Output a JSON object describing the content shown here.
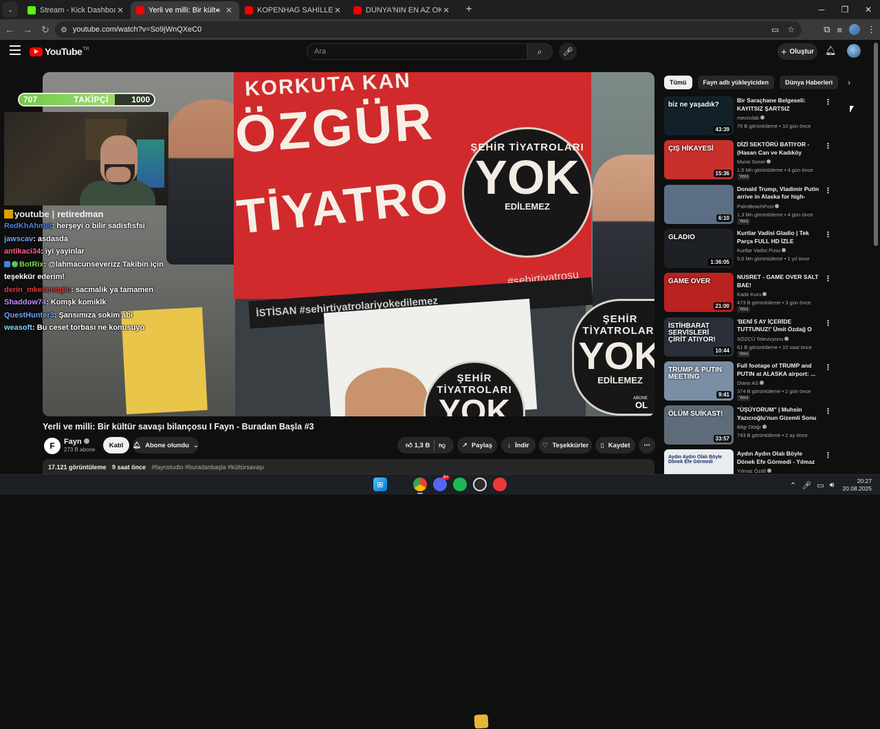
{
  "browser": {
    "tabs": [
      {
        "label": "Stream - Kick Dashboard",
        "icon": "kick-favicon",
        "active": false
      },
      {
        "label": "Yerli ve milli: Bir kültür savaşı",
        "icon": "youtube-favicon",
        "active": true
      },
      {
        "label": "KOPENHAG SAHİLLERİNDE SONBAHAR",
        "icon": "youtube-favicon",
        "active": false
      },
      {
        "label": "DÜNYA'NIN EN AZ OKSİJENE SAHİP",
        "icon": "youtube-favicon",
        "active": false
      }
    ],
    "url": "youtube.com/watch?v=So9jWnQXeC0"
  },
  "youtube": {
    "logo_text": "YouTube",
    "country_code": "TR",
    "search_placeholder": "Ara",
    "create_label": "Oluştur"
  },
  "overlay": {
    "follow_current": "707",
    "follow_label": "TAKİPÇİ",
    "follow_goal": "1000",
    "follow_progress": 0.707,
    "channel_prefix": "youtube",
    "channel_name": "retiredman",
    "chat": [
      {
        "user": "RedKhAhmet",
        "text": ": herşeyi o bilir sadisfisfsi",
        "color": "#4f7fe0",
        "badges": []
      },
      {
        "user": "jawscav",
        "text": ": asdasda",
        "color": "#6ea2ff",
        "badges": []
      },
      {
        "user": "antikaci34",
        "text": ": iyi yayinlar",
        "color": "#ff5e8e",
        "badges": []
      },
      {
        "user": "BotRix",
        "text": ": @lahmacunseverizz Takibin için",
        "color": "#7ddc45",
        "badges": [
          "bot",
          "verified"
        ]
      },
      {
        "user": "",
        "text": "teşekkür ederim!",
        "color": "#ffffff",
        "badges": []
      },
      {
        "user": "derin_mkelamoglu",
        "text": ": sacmalik ya tamamen",
        "color": "#e0393e",
        "badges": []
      },
      {
        "user": "Shaddow74",
        "text": ": Komşk komiklk",
        "color": "#c58cff",
        "badges": []
      },
      {
        "user": "QuestHunter3",
        "text": ": Şansımıza sokim abi",
        "color": "#6ea2ff",
        "badges": []
      },
      {
        "user": "weasoft",
        "text": ": Bu ceset torbası ne konusuyo",
        "color": "#7fd3ff",
        "badges": []
      }
    ]
  },
  "video": {
    "banner_line1": "KORKUTA KAN",
    "banner_line2": "ÖZGÜR",
    "banner_line3": "TİYATRO",
    "banner_tag": "#sehirtiyatrosu",
    "banner_black": "İSTİSAN  #sehirtiyatrolariyokedilemez",
    "stamp_top": "ŞEHİR TİYATROLARI",
    "stamp_mid": "YOK",
    "stamp_bottom": "EDİLEMEZ",
    "watermark_top": "ABONE",
    "watermark_bottom": "OL",
    "title": "Yerli ve milli: Bir kültür savaşı bilançosu I Fayn - Buradan Başla #3",
    "channel": "Fayn",
    "channel_logo": "F",
    "subscribers": "273 B abone",
    "join_label": "Katıl",
    "subscribed_label": "Abone olundu",
    "likes": "1,3 B",
    "share_label": "Paylaş",
    "download_label": "İndir",
    "thanks_label": "Teşekkürler",
    "save_label": "Kaydet",
    "views": "17.121 görüntüleme",
    "age": "9 saat önce",
    "tags": "#faynstudio #buradanbaşla #kültürsavaşı"
  },
  "sidebar": {
    "chips": [
      "Tümü",
      "Fayn adlı yükleyiciden",
      "Dünya Haberleri"
    ],
    "recommendations": [
      {
        "title": "Bir Saraçhane Belgeseli: KAYITSIZ ŞARTSIZ",
        "channel": "mevzulab",
        "meta": "70 B görüntüleme • 10 gün önce",
        "duration": "43:39",
        "new": "",
        "thumb_text": "biz ne yaşadık?",
        "thumb_bg": "#12202a"
      },
      {
        "title": "DİZİ SEKTÖRÜ BATIYOR - (Hasan Can ve Kadıköy Boğası...",
        "channel": "Murat Soner",
        "meta": "1,5 Mn görüntüleme • 4 gün önce",
        "duration": "15:36",
        "new": "Yeni",
        "thumb_text": "ÇIŞ HİKAYESİ",
        "thumb_bg": "#c9302c"
      },
      {
        "title": "Donald Trump, Vladimir Putin arrive in Alaska for high-stake...",
        "channel": "PalmBeachPost",
        "meta": "1,3 Mn görüntüleme • 4 gün önce",
        "duration": "6:10",
        "new": "Yeni",
        "thumb_text": "",
        "thumb_bg": "#5b6e84"
      },
      {
        "title": "Kurtlar Vadisi Gladio | Tek Parça FULL HD İZLE",
        "channel": "Kurtlar Vadisi Pusu",
        "meta": "5,6 Mn görüntüleme • 1 yıl önce",
        "duration": "1:36:05",
        "new": "",
        "thumb_text": "GLADIO",
        "thumb_bg": "#1d2024"
      },
      {
        "title": "NUSRET - GAME OVER SALT BAE!",
        "channel": "Kadir Kuru",
        "meta": "473 B görüntüleme • 3 gün önce",
        "duration": "21:00",
        "new": "Yeni",
        "thumb_text": "GAME OVER",
        "thumb_bg": "#b8221f"
      },
      {
        "title": "'BENİ 5 AY İÇERİDE TUTTUNUZ!' Ümit Özdağ O Belgeleri ...",
        "channel": "SÖZCÜ Televizyonu",
        "meta": "61 B görüntüleme • 10 saat önce",
        "duration": "10:44",
        "new": "Yeni",
        "thumb_text": "İSTİHBARAT SERVİSLERİ ÇİRİT ATIYOR!",
        "thumb_bg": "#2a2f3a"
      },
      {
        "title": "Full footage of TRUMP and PUTIN at ALASKA airport: ...",
        "channel": "Diario AS",
        "meta": "374 B görüntüleme • 2 gün önce",
        "duration": "9:41",
        "new": "Yeni",
        "thumb_text": "TRUMP & PUTIN MEETING",
        "thumb_bg": "#7a8ea5"
      },
      {
        "title": "\"ÜŞÜYORUM\" | Muhsin Yazıcıoğlu'nun Gizemli Sonu",
        "channel": "Bilgi Otağı",
        "meta": "743 B görüntüleme • 2 ay önce",
        "duration": "33:57",
        "new": "",
        "thumb_text": "ÖLÜM SUİKAST!",
        "thumb_bg": "#5d6c78"
      },
      {
        "title": "Aydın Aydın Olalı Böyle Dönek Efe Görmedi - Yılmaz Özdil",
        "channel": "Yılmaz Özdil",
        "meta": "",
        "duration": "",
        "new": "",
        "thumb_text": "Aydın Aydın Olalı Böyle Dönek Efe Görmedi",
        "thumb_bg": "#e9ecef"
      }
    ]
  },
  "taskbar": {
    "discord_badge": "9+",
    "time": "20:27",
    "date": "20.08.2025"
  }
}
